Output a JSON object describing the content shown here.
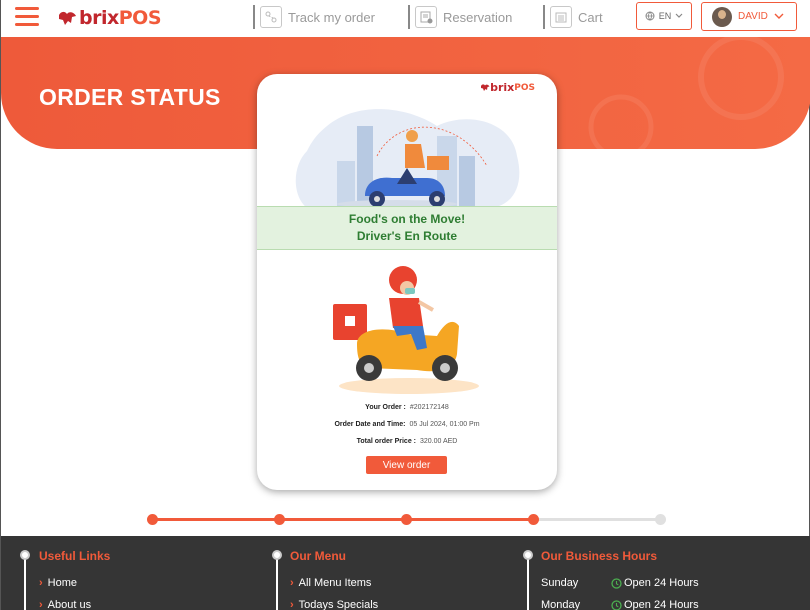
{
  "header": {
    "logo_brand": "brix",
    "logo_suffix": "POS",
    "nav": [
      {
        "label": "Track my order",
        "icon": "track-icon"
      },
      {
        "label": "Reservation",
        "icon": "reservation-icon"
      },
      {
        "label": "Cart",
        "icon": "cart-icon"
      }
    ],
    "language": "EN",
    "user_name": "DAVID"
  },
  "banner": {
    "title": "ORDER STATUS"
  },
  "card": {
    "logo_brand": "brix",
    "logo_suffix": "POS",
    "status_line1": "Food's on the Move!",
    "status_line2": "Driver's En Route",
    "order_label": "Your Order :",
    "order_value": "#202172148",
    "date_label": "Order Date and Time:",
    "date_value": "05 Jul 2024, 01:00 Pm",
    "price_label": "Total order Price :",
    "price_value": "320.00 AED",
    "view_button": "View order"
  },
  "progress": {
    "steps_total": 5,
    "steps_completed": 4
  },
  "footer": {
    "useful_links": {
      "title": "Useful Links",
      "items": [
        "Home",
        "About us"
      ]
    },
    "our_menu": {
      "title": "Our Menu",
      "items": [
        "All Menu Items",
        "Todays Specials"
      ]
    },
    "business_hours": {
      "title": "Our Business Hours",
      "rows": [
        {
          "day": "Sunday",
          "hours": "Open 24 Hours"
        },
        {
          "day": "Monday",
          "hours": "Open 24 Hours"
        }
      ]
    }
  },
  "colors": {
    "accent": "#f15a3a",
    "status_green": "#2e7d32",
    "footer_bg": "#353535"
  }
}
